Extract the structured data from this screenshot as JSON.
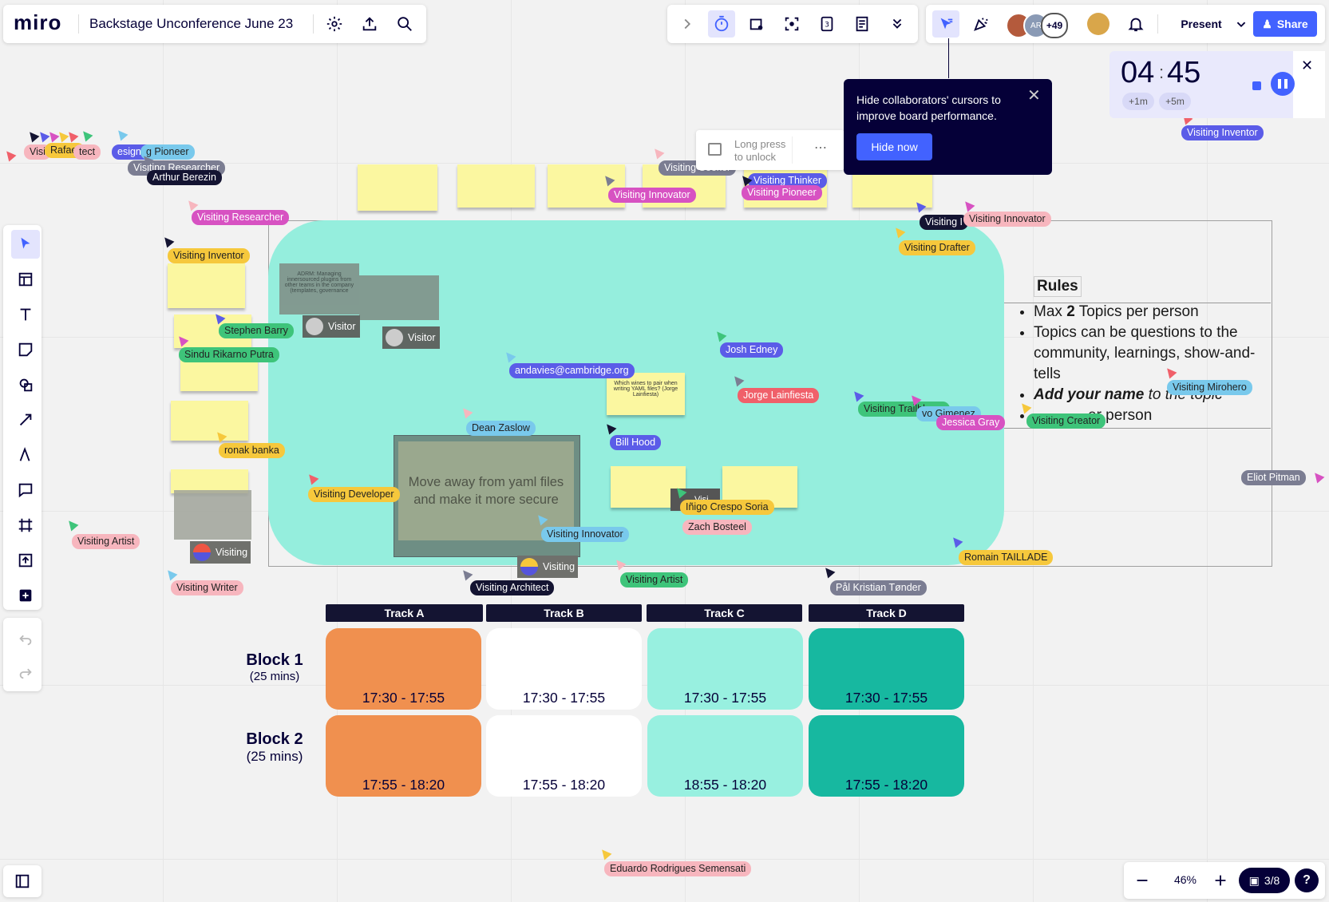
{
  "app": {
    "logo": "miro",
    "board_title": "Backstage Unconference June 23"
  },
  "toolbar_right": {
    "present_label": "Present",
    "share_label": "Share",
    "collaborators_more": "+49",
    "avatar_initials": "AR"
  },
  "lock_hint": {
    "line1": "Long press",
    "line2": "to unlock"
  },
  "tooltip": {
    "text": "Hide collaborators' cursors to improve board performance.",
    "button_label": "Hide now"
  },
  "timer": {
    "minutes": "04",
    "seconds": "45",
    "add1": "+1m",
    "add5": "+5m"
  },
  "zoom": {
    "level": "46%",
    "pages": "3/8",
    "help": "?"
  },
  "rules": {
    "title": "Rules",
    "item1_a": "Max ",
    "item1_b": "2",
    "item1_c": " Topics per person",
    "item2": "Topics can be questions to the community, learnings, show-and-tells",
    "item3_a": "Add your name",
    "item3_b": " to the topic",
    "item4": "er person"
  },
  "cards": {
    "adr": "ADRM: Managing innersourced plugins from other teams in the company (templates, governance",
    "yaml": "Move away from yaml files and make it more secure",
    "wines": "Which wines to pair when writing YAML files? (Jorge Lainfiesta)",
    "visitor1": "Visitor",
    "visitor2": "Visitor",
    "visiting1": "Visiting",
    "visiting2": "Visiting",
    "small_tag": "Visi"
  },
  "schedule": {
    "tracks": [
      "Track A",
      "Track B",
      "Track C",
      "Track D"
    ],
    "blocks": [
      {
        "name": "Block 1",
        "duration": "(25 mins)",
        "slots": [
          "17:30 - 17:55",
          "17:30 - 17:55",
          "17:30 - 17:55",
          "17:30 - 17:55"
        ]
      },
      {
        "name": "Block 2",
        "duration": "(25 mins)",
        "slots": [
          "17:55 - 18:20",
          "17:55 - 18:20",
          "18:55 - 18:20",
          "17:55 - 18:20"
        ]
      }
    ],
    "colors": [
      "#f0904f",
      "#ffffff",
      "#98f0e0",
      "#17b8a0"
    ]
  },
  "cursors": [
    {
      "name": "Visi",
      "bg": "#f7b6be",
      "fg": "#222"
    },
    {
      "name": "Rafael",
      "bg": "#f6c83c",
      "fg": "#222"
    },
    {
      "name": "tect",
      "bg": "#f7b6be",
      "fg": "#222"
    },
    {
      "name": "esigner",
      "bg": "#5b5ce8",
      "fg": "#fff"
    },
    {
      "name": "g Pioneer",
      "bg": "#79c9ec",
      "fg": "#222"
    },
    {
      "name": "Visiting Researcher",
      "bg": "#7b7d92",
      "fg": "#fff"
    },
    {
      "name": "Arthur Berezin",
      "bg": "#141432",
      "fg": "#fff"
    },
    {
      "name": "Visiting Researcher",
      "bg": "#d752c2",
      "fg": "#fff"
    },
    {
      "name": "Visiting Inventor",
      "bg": "#f6c83c",
      "fg": "#222"
    },
    {
      "name": "Stephen Barry",
      "bg": "#3ec47a",
      "fg": "#222"
    },
    {
      "name": "Sindu Rikarno Putra",
      "bg": "#3ec47a",
      "fg": "#222"
    },
    {
      "name": "ronak banka",
      "bg": "#f6c83c",
      "fg": "#222"
    },
    {
      "name": "Visiting Developer",
      "bg": "#f6c83c",
      "fg": "#222"
    },
    {
      "name": "Visiting Artist",
      "bg": "#f7b6be",
      "fg": "#222"
    },
    {
      "name": "Visiting Writer",
      "bg": "#f7b6be",
      "fg": "#222"
    },
    {
      "name": "Visiting Innovator",
      "bg": "#d752c2",
      "fg": "#fff"
    },
    {
      "name": "Visiting Seeker",
      "bg": "#7b7d92",
      "fg": "#fff"
    },
    {
      "name": "Visiting Thinker",
      "bg": "#5b5ce8",
      "fg": "#fff"
    },
    {
      "name": "Visiting Pioneer",
      "bg": "#d752c2",
      "fg": "#fff"
    },
    {
      "name": "Visiting Inventor",
      "bg": "#5b5ce8",
      "fg": "#fff"
    },
    {
      "name": "Visiting I",
      "bg": "#141432",
      "fg": "#fff"
    },
    {
      "name": "Visiting Innovator",
      "bg": "#f7b6be",
      "fg": "#222"
    },
    {
      "name": "Visiting Drafter",
      "bg": "#f6c83c",
      "fg": "#222"
    },
    {
      "name": "Josh Edney",
      "bg": "#5b5ce8",
      "fg": "#fff"
    },
    {
      "name": "andavies@cambridge.org",
      "bg": "#5b5ce8",
      "fg": "#fff"
    },
    {
      "name": "Jorge Lainfiesta",
      "bg": "#f0606a",
      "fg": "#fff"
    },
    {
      "name": "Dean Zaslow",
      "bg": "#79c9ec",
      "fg": "#222"
    },
    {
      "name": "Bill Hood",
      "bg": "#5b5ce8",
      "fg": "#fff"
    },
    {
      "name": "Visiting Trailblazer",
      "bg": "#3ec47a",
      "fg": "#222"
    },
    {
      "name": "vo Gimenez",
      "bg": "#79c9ec",
      "fg": "#222"
    },
    {
      "name": "Jessica Gray",
      "bg": "#d752c2",
      "fg": "#fff"
    },
    {
      "name": "Visiting Creator",
      "bg": "#3ec47a",
      "fg": "#222"
    },
    {
      "name": "Visiting Mirohero",
      "bg": "#79c9ec",
      "fg": "#222"
    },
    {
      "name": "Iñigo Crespo Soria",
      "bg": "#f6c83c",
      "fg": "#222"
    },
    {
      "name": "Zach Bosteel",
      "bg": "#f7b6be",
      "fg": "#222"
    },
    {
      "name": "Visiting Innovator",
      "bg": "#79c9ec",
      "fg": "#222"
    },
    {
      "name": "Visiting Architect",
      "bg": "#141432",
      "fg": "#fff"
    },
    {
      "name": "Visiting Artist",
      "bg": "#3ec47a",
      "fg": "#222"
    },
    {
      "name": "Pål Kristian Tønder",
      "bg": "#7b7d92",
      "fg": "#fff"
    },
    {
      "name": "Romain TAILLADE",
      "bg": "#f6c83c",
      "fg": "#222"
    },
    {
      "name": "Eliot Pitman",
      "bg": "#7b7d92",
      "fg": "#fff"
    },
    {
      "name": "Eduardo Rodrigues Semensati",
      "bg": "#f7b6be",
      "fg": "#222"
    }
  ],
  "icons": [
    "settings-icon",
    "upload-icon",
    "search-icon",
    "chevron-right-icon",
    "timer-icon",
    "voting-icon",
    "focus-icon",
    "counter-icon",
    "notes-icon",
    "chevrons-down-icon",
    "cursor-filter-icon",
    "celebrate-icon",
    "bell-icon",
    "select-icon",
    "templates-icon",
    "text-icon",
    "sticky-icon",
    "shapes-icon",
    "pen-icon",
    "connector-icon",
    "comment-icon",
    "frame-icon",
    "upload-icon",
    "plus-icon",
    "undo-icon",
    "redo-icon",
    "board-list-icon",
    "lock-icon",
    "more-icon",
    "close-icon",
    "stop-icon",
    "pause-icon",
    "minus-icon",
    "plus-icon",
    "gift-icon"
  ]
}
